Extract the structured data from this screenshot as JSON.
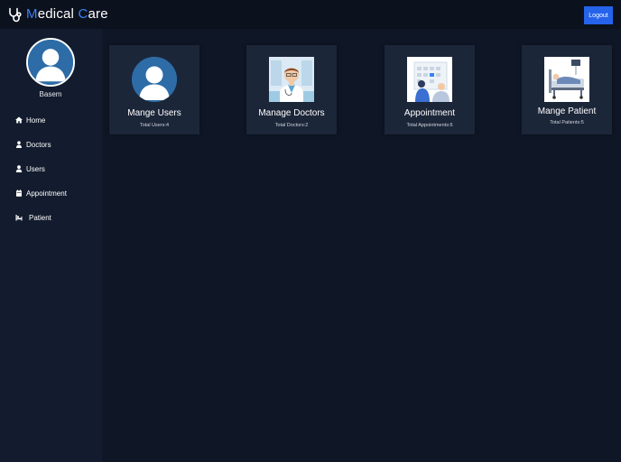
{
  "header": {
    "brand": {
      "first_letter": "M",
      "first_rest": "edical ",
      "second_letter": "C",
      "second_rest": "are"
    },
    "logout_label": "Logout",
    "colors": {
      "accent": "#3b82f6",
      "button": "#2563eb",
      "background": "#0b111d"
    },
    "icon": "stethoscope-icon"
  },
  "sidebar": {
    "user_name": "Basem",
    "items": [
      {
        "label": "Home",
        "icon": "home-icon"
      },
      {
        "label": "Doctors",
        "icon": "doctor-icon"
      },
      {
        "label": "Users",
        "icon": "user-icon"
      },
      {
        "label": "Appointment",
        "icon": "calendar-icon"
      },
      {
        "label": "Patient",
        "icon": "hospital-bed-icon"
      }
    ]
  },
  "cards": [
    {
      "title": "Mange Users",
      "subtitle": "Total Users:4",
      "image": "user-avatar-image"
    },
    {
      "title": "Manage Doctors",
      "subtitle": "Total Doctors:2",
      "image": "doctor-illustration"
    },
    {
      "title": "Appointment",
      "subtitle": "Total Appointments:6",
      "image": "appointment-illustration"
    },
    {
      "title": "Mange Patient",
      "subtitle": "Total Patients:5",
      "image": "patient-bed-illustration"
    }
  ]
}
